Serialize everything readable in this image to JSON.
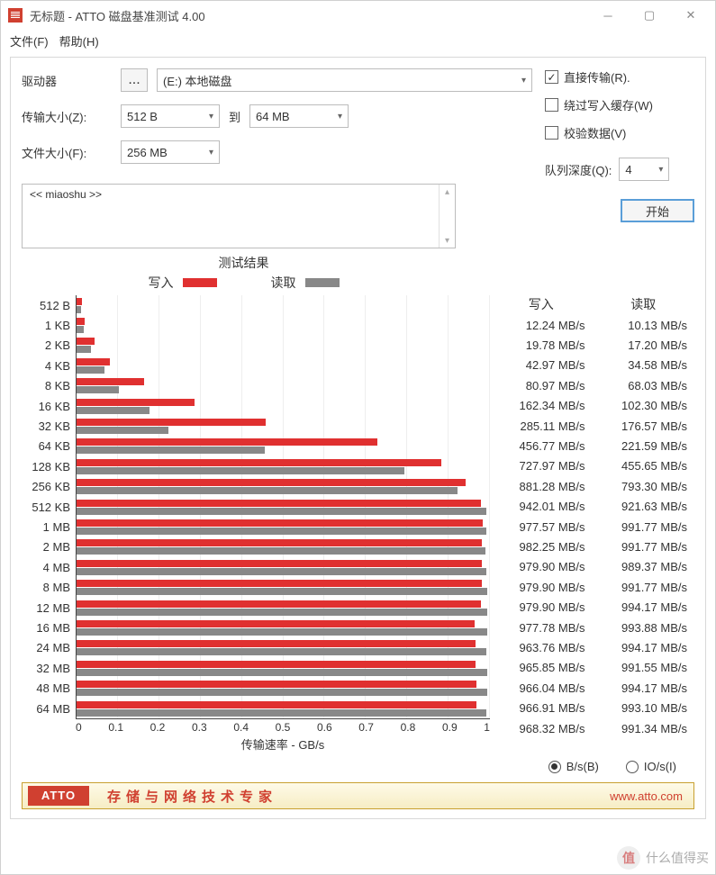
{
  "window": {
    "title": "无标题 - ATTO 磁盘基准测试 4.00"
  },
  "menu": {
    "file": "文件(F)",
    "help": "帮助(H)"
  },
  "labels": {
    "drive": "驱动器",
    "transfer_size": "传输大小(Z):",
    "to": "到",
    "file_size": "文件大小(F):",
    "direct": "直接传输(R).",
    "bypass": "绕过写入缓存(W)",
    "verify": "校验数据(V)",
    "queue_depth": "队列深度(Q):",
    "start": "开始",
    "results_title": "测试结果",
    "write": "写入",
    "read": "读取",
    "xlabel": "传输速率 - GB/s",
    "units_bs": "B/s(B)",
    "units_io": "IO/s(I)"
  },
  "icons": {
    "browse": "..."
  },
  "values": {
    "drive": "(E:) 本地磁盘",
    "tx_from": "512 B",
    "tx_to": "64 MB",
    "file_size": "256 MB",
    "queue_depth": "4",
    "description": "<< miaoshu >>"
  },
  "checkboxes": {
    "direct": true,
    "bypass": false,
    "verify": false
  },
  "footer": {
    "logo": "ATTO",
    "tagline": "存储与网络技术专家",
    "url": "www.atto.com"
  },
  "watermark": {
    "icon": "值",
    "text": "什么值得买"
  },
  "chart_data": {
    "type": "bar",
    "title": "测试结果",
    "xlabel": "传输速率 - GB/s",
    "xlim": [
      0,
      1.0
    ],
    "xticks": [
      "0",
      "0.1",
      "0.2",
      "0.3",
      "0.4",
      "0.5",
      "0.6",
      "0.7",
      "0.8",
      "0.9",
      "1"
    ],
    "unit": "MB/s",
    "categories": [
      "512 B",
      "1 KB",
      "2 KB",
      "4 KB",
      "8 KB",
      "16 KB",
      "32 KB",
      "64 KB",
      "128 KB",
      "256 KB",
      "512 KB",
      "1 MB",
      "2 MB",
      "4 MB",
      "8 MB",
      "12 MB",
      "16 MB",
      "24 MB",
      "32 MB",
      "48 MB",
      "64 MB"
    ],
    "series": [
      {
        "name": "写入",
        "color": "#e03030",
        "values": [
          12.24,
          19.78,
          42.97,
          80.97,
          162.34,
          285.11,
          456.77,
          727.97,
          881.28,
          942.01,
          977.57,
          982.25,
          979.9,
          979.9,
          979.9,
          977.78,
          963.76,
          965.85,
          966.04,
          966.91,
          968.32
        ]
      },
      {
        "name": "读取",
        "color": "#888888",
        "values": [
          10.13,
          17.2,
          34.58,
          68.03,
          102.3,
          176.57,
          221.59,
          455.65,
          793.3,
          921.63,
          991.77,
          991.77,
          989.37,
          991.77,
          994.17,
          993.88,
          994.17,
          991.55,
          994.17,
          993.1,
          991.34
        ]
      }
    ]
  }
}
